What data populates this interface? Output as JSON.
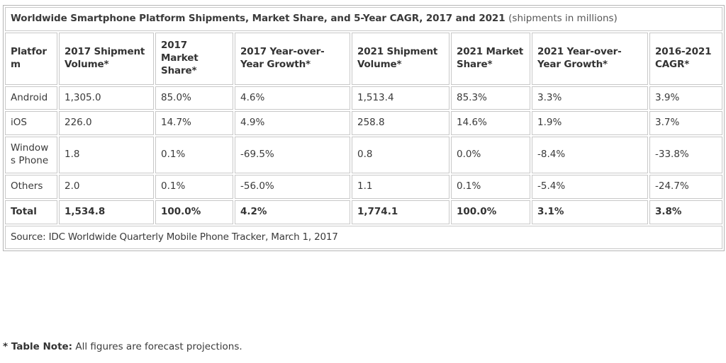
{
  "table": {
    "title_main": "Worldwide Smartphone Platform Shipments, Market Share, and 5-Year CAGR, 2017 and 2021",
    "title_sub": "(shipments in millions)",
    "columns": [
      "Platform",
      "2017 Shipment Volume*",
      "2017 Market Share*",
      "2017 Year-over-Year Growth*",
      "2021 Shipment Volume*",
      "2021 Market Share*",
      "2021 Year-over-Year Growth*",
      "2016-2021 CAGR*"
    ],
    "rows": [
      {
        "platform": "Android",
        "shipment_2017": "1,305.0",
        "share_2017": "85.0%",
        "growth_2017": "4.6%",
        "shipment_2021": "1,513.4",
        "share_2021": "85.3%",
        "growth_2021": "3.3%",
        "cagr": "3.9%"
      },
      {
        "platform": "iOS",
        "shipment_2017": "226.0",
        "share_2017": "14.7%",
        "growth_2017": "4.9%",
        "shipment_2021": "258.8",
        "share_2021": "14.6%",
        "growth_2021": "1.9%",
        "cagr": "3.7%"
      },
      {
        "platform": "Windows Phone",
        "shipment_2017": "1.8",
        "share_2017": "0.1%",
        "growth_2017": "-69.5%",
        "shipment_2021": "0.8",
        "share_2021": "0.0%",
        "growth_2021": "-8.4%",
        "cagr": "-33.8%"
      },
      {
        "platform": "Others",
        "shipment_2017": "2.0",
        "share_2017": "0.1%",
        "growth_2017": "-56.0%",
        "shipment_2021": "1.1",
        "share_2021": "0.1%",
        "growth_2021": "-5.4%",
        "cagr": "-24.7%"
      }
    ],
    "total_row": {
      "platform": "Total",
      "shipment_2017": "1,534.8",
      "share_2017": "100.0%",
      "growth_2017": "4.2%",
      "shipment_2021": "1,774.1",
      "share_2021": "100.0%",
      "growth_2021": "3.1%",
      "cagr": "3.8%"
    },
    "source": "Source: IDC Worldwide Quarterly Mobile Phone Tracker, March 1, 2017"
  },
  "footnote": {
    "marker": "*",
    "label": "Table Note:",
    "text": "All figures are forecast projections."
  },
  "chart_data": {
    "type": "table",
    "title": "Worldwide Smartphone Platform Shipments, Market Share, and 5-Year CAGR, 2017 and 2021 (shipments in millions)",
    "columns": [
      "Platform",
      "2017 Shipment Volume*",
      "2017 Market Share*",
      "2017 Year-over-Year Growth*",
      "2021 Shipment Volume*",
      "2021 Market Share*",
      "2021 Year-over-Year Growth*",
      "2016-2021 CAGR*"
    ],
    "rows": [
      [
        "Android",
        "1,305.0",
        "85.0%",
        "4.6%",
        "1,513.4",
        "85.3%",
        "3.3%",
        "3.9%"
      ],
      [
        "iOS",
        "226.0",
        "14.7%",
        "4.9%",
        "258.8",
        "14.6%",
        "1.9%",
        "3.7%"
      ],
      [
        "Windows Phone",
        "1.8",
        "0.1%",
        "-69.5%",
        "0.8",
        "0.0%",
        "-8.4%",
        "-33.8%"
      ],
      [
        "Others",
        "2.0",
        "0.1%",
        "-56.0%",
        "1.1",
        "0.1%",
        "-5.4%",
        "-24.7%"
      ],
      [
        "Total",
        "1,534.8",
        "100.0%",
        "4.2%",
        "1,774.1",
        "100.0%",
        "3.1%",
        "3.8%"
      ]
    ],
    "source": "Source: IDC Worldwide Quarterly Mobile Phone Tracker, March 1, 2017",
    "note": "* Table Note: All figures are forecast projections."
  }
}
